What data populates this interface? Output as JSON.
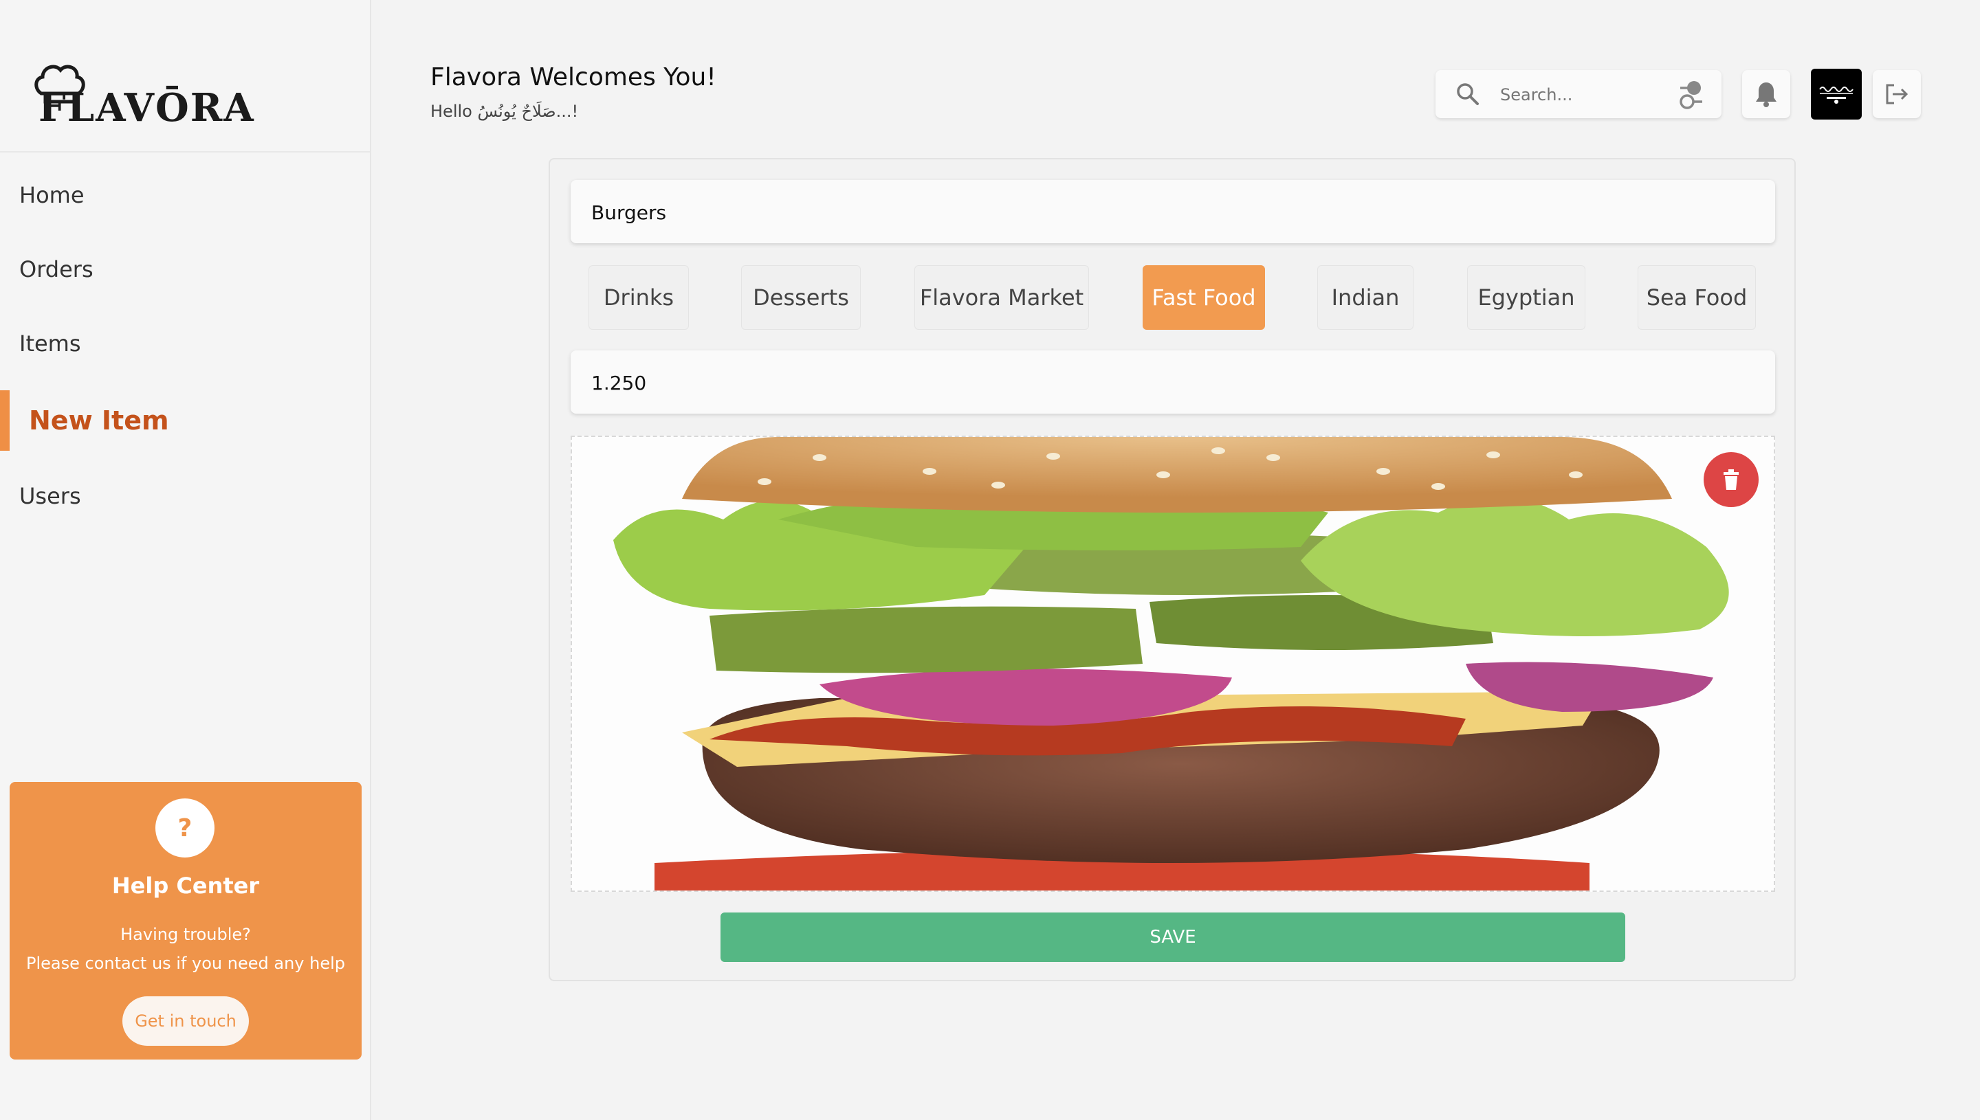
{
  "brand": {
    "name": "FLAVŌRA"
  },
  "sidebar": {
    "items": [
      {
        "label": "Home"
      },
      {
        "label": "Orders"
      },
      {
        "label": "Items"
      },
      {
        "label": "New Item"
      },
      {
        "label": "Users"
      }
    ],
    "active_item": "New Item",
    "help": {
      "icon_glyph": "?",
      "title": "Help Center",
      "line1": "Having trouble?",
      "line2": "Please contact us if you need any help",
      "button": "Get in touch"
    }
  },
  "header": {
    "title": "Flavora Welcomes You!",
    "greeting": "Hello صَلَاحٌ يُونُسُ...!"
  },
  "search": {
    "placeholder": "Search..."
  },
  "form": {
    "name_value": "Burgers",
    "price_value": "1.250",
    "categories": [
      {
        "label": "Drinks"
      },
      {
        "label": "Desserts"
      },
      {
        "label": "Flavora Market"
      },
      {
        "label": "Fast Food"
      },
      {
        "label": "Indian"
      },
      {
        "label": "Egyptian"
      },
      {
        "label": "Sea Food"
      }
    ],
    "selected_category": "Fast Food",
    "save_label": "SAVE"
  },
  "colors": {
    "accent": "#ef944a",
    "active_nav": "#c4521b",
    "save": "#55b784",
    "delete": "#dd4545"
  },
  "icons": [
    "chef-hat-icon",
    "search-icon",
    "filter-icon",
    "bell-icon",
    "flag-icon",
    "logout-icon",
    "trash-icon",
    "question-icon"
  ]
}
